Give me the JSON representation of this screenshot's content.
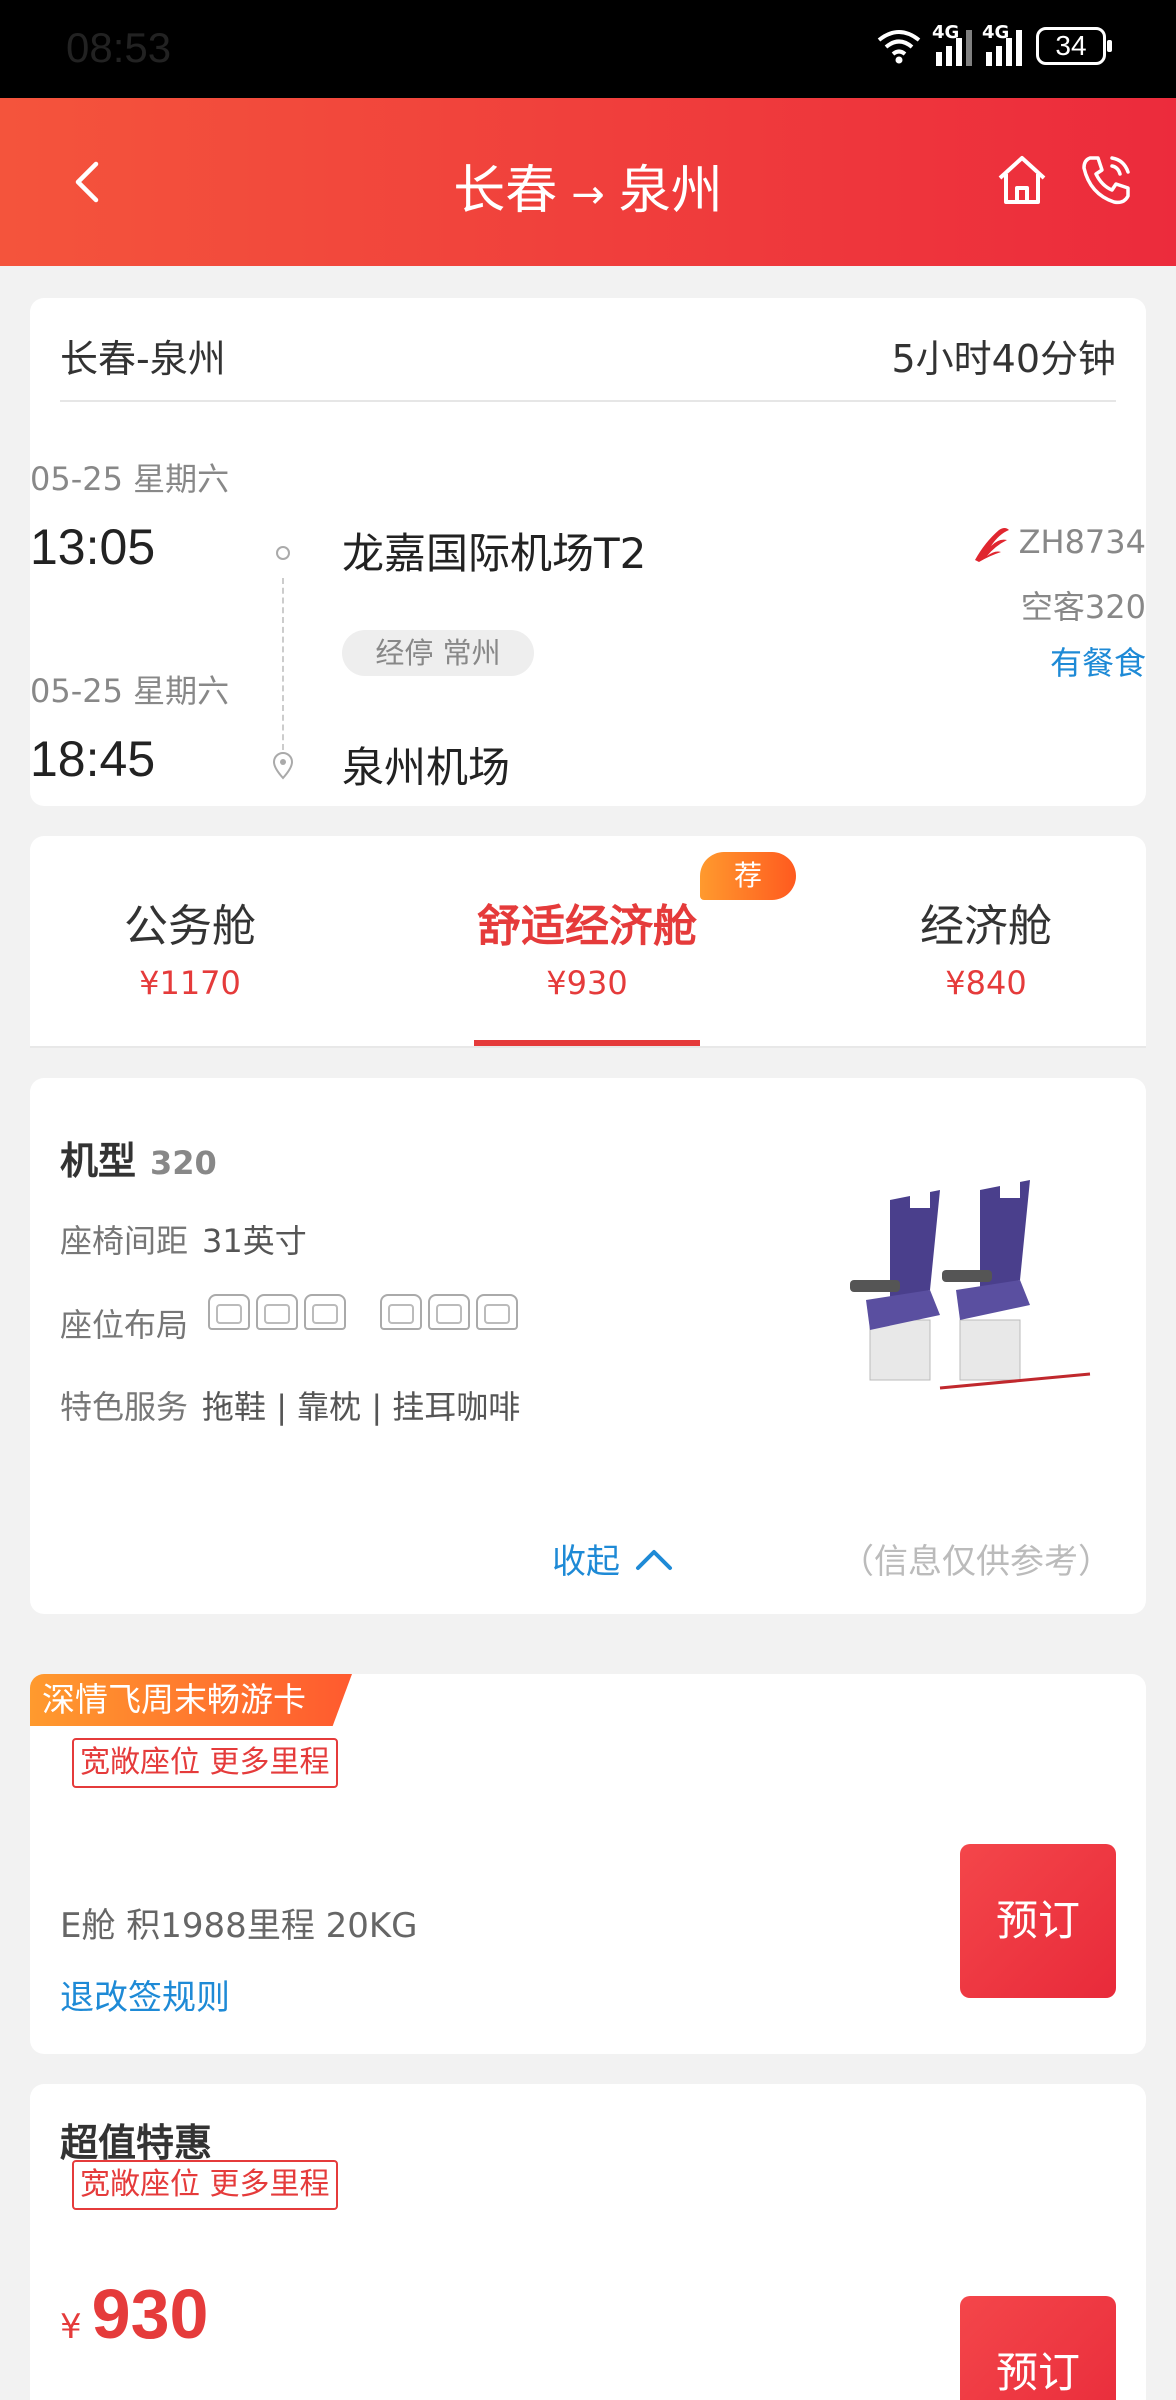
{
  "status_bar": {
    "time": "08:53",
    "battery": "34",
    "network_1": "4G",
    "network_2": "4G"
  },
  "header": {
    "from": "长春",
    "arrow": "→",
    "to": "泉州"
  },
  "flight": {
    "route": "长春-泉州",
    "duration": "5小时40分钟",
    "depart": {
      "date": "05-25 星期六",
      "time": "13:05",
      "airport": "龙嘉国际机场T2"
    },
    "arrive": {
      "date": "05-25 星期六",
      "time": "18:45",
      "airport": "泉州机场"
    },
    "stopover": "经停 常州",
    "flight_no": "ZH8734",
    "aircraft": "空客320",
    "meal": "有餐食"
  },
  "cabins": [
    {
      "name": "公务舱",
      "price": "¥1170"
    },
    {
      "name": "舒适经济舱",
      "price": "¥930",
      "badge": "荐"
    },
    {
      "name": "经济舱",
      "price": "¥840"
    }
  ],
  "aircraft_info": {
    "model_label": "机型",
    "model_value": "320",
    "pitch_label": "座椅间距",
    "pitch_value": "31英寸",
    "layout_label": "座位布局",
    "service_label": "特色服务",
    "service_value": "拖鞋 | 靠枕 | 挂耳咖啡",
    "collapse_label": "收起",
    "disclaimer": "（信息仅供参考）"
  },
  "offers": [
    {
      "ribbon": "深情飞周末畅游卡",
      "tag": "宽敞座位 更多里程",
      "info": "E舱 积1988里程 20KG",
      "rules": "退改签规则",
      "book": "预订"
    },
    {
      "title": "超值特惠",
      "tag": "宽敞座位 更多里程",
      "currency": "¥",
      "price": "930",
      "book": "预订"
    }
  ],
  "colors": {
    "brand_red": "#e53b3b",
    "link_blue": "#1e8ad6",
    "header_start": "#f4543c",
    "header_end": "#ec2b3c"
  }
}
